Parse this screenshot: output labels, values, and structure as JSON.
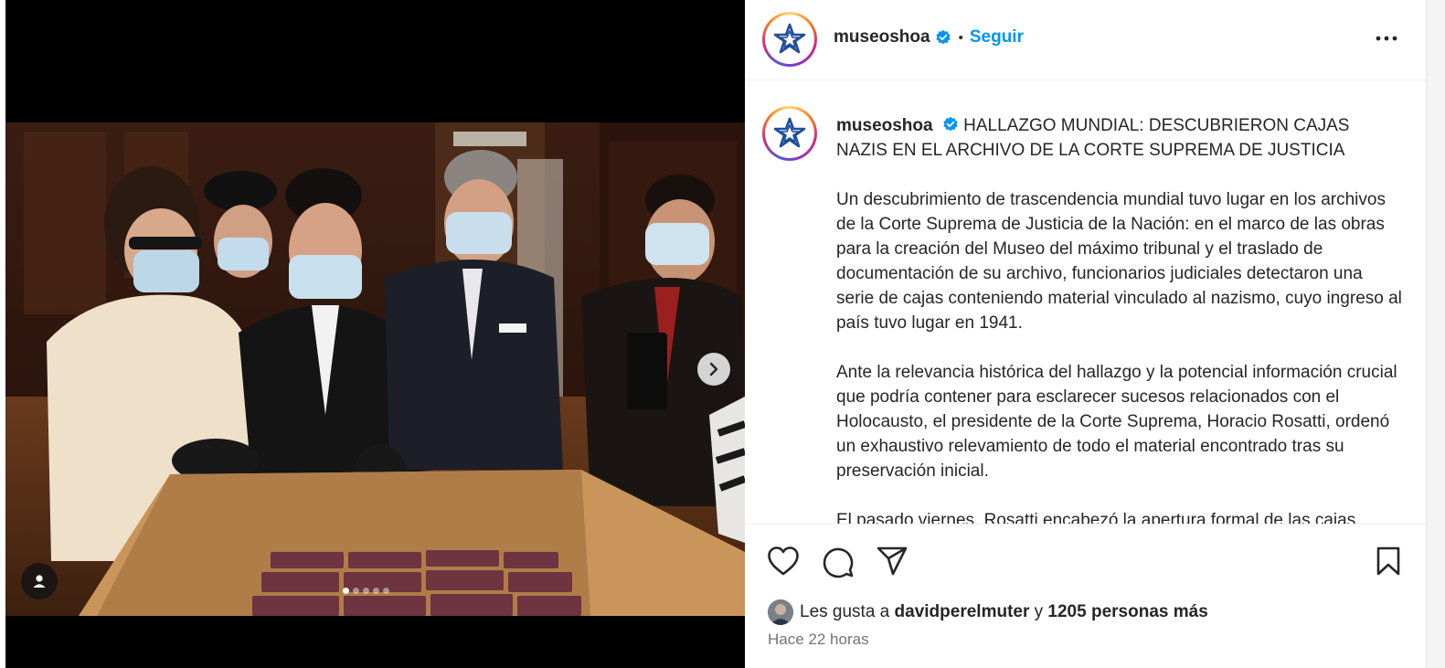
{
  "post": {
    "username": "museoshoa",
    "follow_label": "Seguir",
    "separator": "•",
    "headline": "HALLAZGO MUNDIAL: DESCUBRIERON CAJAS NAZIS EN EL ARCHIVO DE LA CORTE SUPREMA DE JUSTICIA",
    "paragraphs": [
      "Un descubrimiento de trascendencia mundial tuvo lugar en los archivos de la Corte Suprema de Justicia de la Nación: en el marco de las obras para la creación del Museo del máximo tribunal y el traslado de documentación de su archivo, funcionarios judiciales detectaron una serie de cajas conteniendo material vinculado al nazismo, cuyo ingreso al país tuvo lugar en 1941.",
      "Ante la relevancia histórica del hallazgo y la potencial información crucial que podría contener para esclarecer sucesos relacionados con el Holocausto, el presidente de la Corte Suprema, Horacio Rosatti, ordenó un exhaustivo relevamiento de todo el material encontrado tras su preservación inicial.",
      "El pasado viernes, Rosatti encabezó la apertura formal de las cajas"
    ]
  },
  "likes": {
    "prefix": "Les gusta a",
    "user": "davidperelmuter",
    "connector": "y",
    "others": "1205 personas más"
  },
  "timestamp": "Hace 22 horas",
  "carousel": {
    "total_slides": 5,
    "active_slide": 1
  },
  "icons": [
    "verified-badge-icon",
    "more-options-icon",
    "heart-icon",
    "comment-icon",
    "share-icon",
    "bookmark-icon",
    "chevron-right-icon",
    "user-tag-icon"
  ],
  "colors": {
    "follow": "#0095f6",
    "verified": "#0095f6",
    "muted_text": "#737373"
  }
}
